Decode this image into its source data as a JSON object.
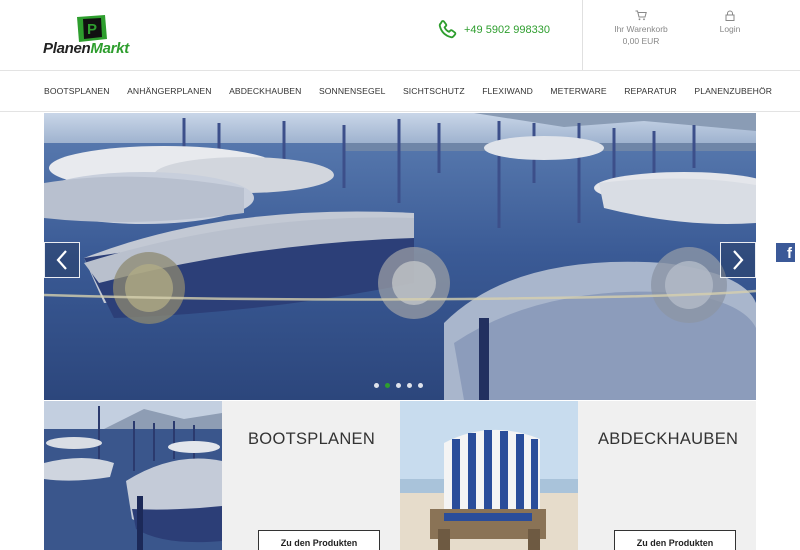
{
  "header": {
    "logo_text_a": "Planen",
    "logo_text_b": "Markt",
    "phone": "+49 5902 998330",
    "cart_label": "Ihr Warenkorb",
    "cart_amount": "0,00 EUR",
    "login_label": "Login",
    "brand_green": "#2e9e2e"
  },
  "nav": {
    "items": [
      "BOOTSPLANEN",
      "ANHÄNGERPLANEN",
      "ABDECKHAUBEN",
      "SONNENSEGEL",
      "SICHTSCHUTZ",
      "FLEXIWAND",
      "METERWARE",
      "REPARATUR",
      "PLANENZUBEHÖR"
    ]
  },
  "slider": {
    "slide_count": 5,
    "active_index": 1,
    "prev_icon": "chevron-left-icon",
    "next_icon": "chevron-right-icon"
  },
  "social": {
    "facebook_glyph": "f"
  },
  "tiles": [
    {
      "title": "BOOTSPLANEN",
      "button": "Zu den Produkten"
    },
    {
      "title": "ABDECKHAUBEN",
      "button": "Zu den Produkten"
    }
  ]
}
